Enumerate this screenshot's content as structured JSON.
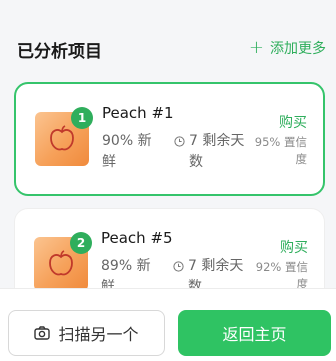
{
  "section": {
    "title": "已分析项目",
    "add_more": "添加更多"
  },
  "items": [
    {
      "rank": "1",
      "name": "Peach #1",
      "freshness": "90% 新鲜",
      "days_left": "7 剩余天数",
      "buy": "购买",
      "confidence": "95% 置信度",
      "selected": true
    },
    {
      "rank": "2",
      "name": "Peach #5",
      "freshness": "89% 新鲜",
      "days_left": "7 剩余天数",
      "buy": "购买",
      "confidence": "92% 置信度",
      "selected": false
    }
  ],
  "bottom": {
    "scan_label": "扫描另一个",
    "home_label": "返回主页"
  },
  "colors": {
    "accent": "#2fae5c",
    "primary_button": "#2fc363",
    "selected_border": "#35c46b"
  },
  "icons": {
    "item_icon": "apple-icon",
    "time_icon": "clock-icon",
    "scan_icon": "camera-icon",
    "add_icon": "plus-icon"
  }
}
